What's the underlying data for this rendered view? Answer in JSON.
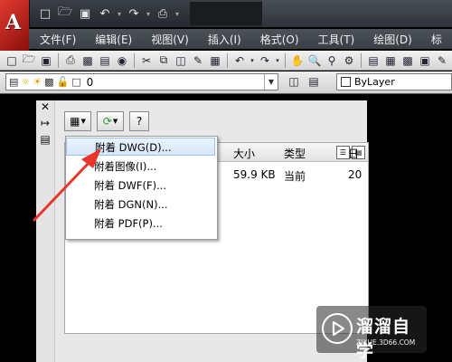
{
  "quick_access": {
    "icons": [
      "new-file-icon",
      "open-folder-icon",
      "save-icon",
      "undo-icon",
      "redo-icon",
      "plot-icon"
    ]
  },
  "menu_bar": {
    "items": [
      "文件(F)",
      "编辑(E)",
      "视图(V)",
      "插入(I)",
      "格式(O)",
      "工具(T)",
      "绘图(D)",
      "标"
    ]
  },
  "layer_toolbar": {
    "layer_value": "0",
    "linetype_value": "ByLayer"
  },
  "external_references": {
    "columns": [
      "大小",
      "类型",
      "日"
    ],
    "row": {
      "size": "59.9 KB",
      "type": "当前",
      "date": "20"
    }
  },
  "context_menu": {
    "items": [
      "附着 DWG(D)...",
      "附着图像(I)...",
      "附着 DWF(F)...",
      "附着 DGN(N)...",
      "附着 PDF(P)..."
    ]
  },
  "watermark": {
    "name": "溜溜自学",
    "url": "ZIXUE.3D66.COM"
  },
  "colors": {
    "accent_red": "#e8362c",
    "menu_bg": "#40444b",
    "highlight": "#d6e8fb"
  }
}
